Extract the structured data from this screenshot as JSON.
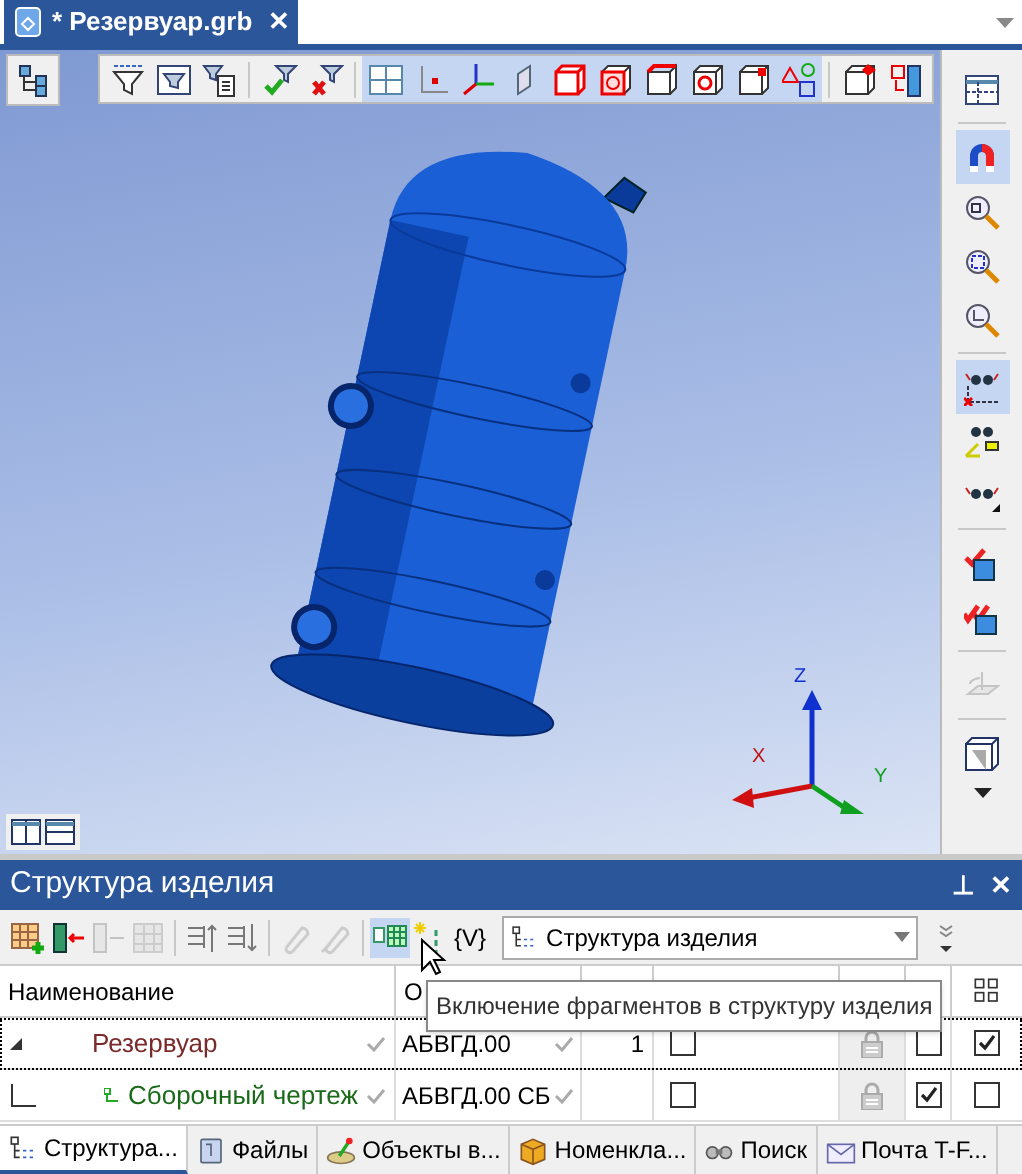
{
  "document_tab": {
    "title": "* Резервуар.grb",
    "close": "✕",
    "selected": true
  },
  "view_toolbar": [
    {
      "selected": false,
      "disabled": false
    },
    {
      "selected": false,
      "disabled": false
    },
    {
      "selected": false,
      "disabled": false
    },
    {
      "disabled": false
    },
    {
      "disabled": false
    },
    {
      "selected": true,
      "disabled": false
    },
    {
      "selected": true,
      "disabled": false
    },
    {
      "selected": true,
      "disabled": false
    },
    {
      "selected": true,
      "disabled": false
    },
    {
      "selected": true,
      "disabled": false
    },
    {
      "selected": true,
      "disabled": false
    },
    {
      "selected": true,
      "disabled": false
    },
    {
      "selected": true,
      "disabled": false
    },
    {
      "selected": true,
      "disabled": false
    },
    {
      "selected": true,
      "disabled": false
    },
    {
      "selected": false,
      "disabled": false
    },
    {
      "selected": false,
      "disabled": false
    }
  ],
  "axes": {
    "x": "X",
    "y": "Y",
    "z": "Z"
  },
  "right_toolbar": [
    {
      "selected": false,
      "disabled": false
    },
    {
      "selected": true,
      "disabled": false
    },
    {
      "selected": false,
      "disabled": false
    },
    {
      "selected": false,
      "disabled": false
    },
    {
      "selected": false,
      "disabled": false
    },
    {
      "selected": true,
      "disabled": false
    },
    {
      "selected": false,
      "disabled": false
    },
    {
      "selected": false,
      "disabled": false
    },
    {
      "disabled": false
    },
    {
      "disabled": false
    },
    {
      "selected": false,
      "disabled": true
    },
    {
      "selected": false,
      "disabled": false
    }
  ],
  "panel": {
    "title": "Структура изделия",
    "pin": "⊥",
    "close": "✕",
    "toolbar": [
      {
        "selected": false,
        "disabled": false
      },
      {
        "selected": false,
        "disabled": false
      },
      {
        "selected": false,
        "disabled": true
      },
      {
        "selected": false,
        "disabled": true
      },
      {
        "selected": false,
        "disabled": false
      },
      {
        "selected": false,
        "disabled": false
      },
      {
        "selected": false,
        "disabled": true
      },
      {
        "selected": false,
        "disabled": true
      },
      {
        "selected": true,
        "disabled": false
      },
      {
        "selected": false,
        "disabled": false
      }
    ],
    "variables_button": "{V}",
    "view_select": {
      "value": "Структура изделия"
    },
    "columns": [
      "Наименование",
      "О"
    ],
    "rows": [
      {
        "name": "Резервуар",
        "designation": "АБВГД.00",
        "quantity": "1",
        "expanded": true,
        "selected": true,
        "flag_a": false,
        "flag_b": false,
        "flag_c": true
      },
      {
        "name": "Сборочный чертеж",
        "designation": "АБВГД.00 СБ",
        "selected": false,
        "flag_a": false,
        "flag_b": true,
        "flag_c": false
      }
    ],
    "tooltip": "Включение фрагментов в структуру изделия"
  },
  "bottom_tabs": [
    {
      "label": "Структура...",
      "selected": true
    },
    {
      "label": "Файлы",
      "selected": false
    },
    {
      "label": "Объекты в...",
      "selected": false
    },
    {
      "label": "Номенкла...",
      "selected": false
    },
    {
      "label": "Поиск",
      "selected": false
    },
    {
      "label": "Почта T-F...",
      "selected": false
    }
  ]
}
